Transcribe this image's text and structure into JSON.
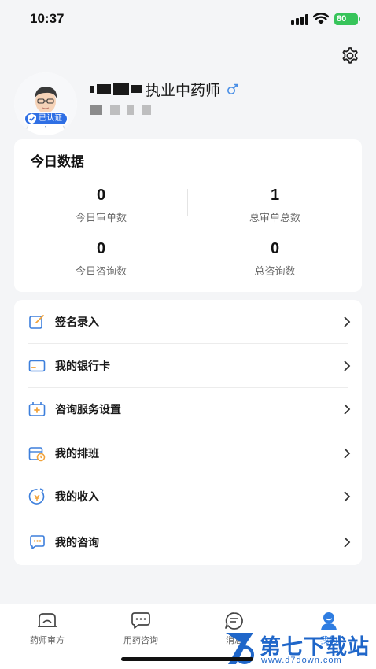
{
  "status_bar": {
    "time": "10:37",
    "battery": "80"
  },
  "profile": {
    "title": "执业中药师",
    "verified_label": "已认证"
  },
  "today_data": {
    "title": "今日数据",
    "stats": [
      {
        "value": "0",
        "label": "今日审单数"
      },
      {
        "value": "1",
        "label": "总审单总数"
      },
      {
        "value": "0",
        "label": "今日咨询数"
      },
      {
        "value": "0",
        "label": "总咨询数"
      }
    ]
  },
  "menu": [
    {
      "label": "签名录入",
      "icon": "signature-icon"
    },
    {
      "label": "我的银行卡",
      "icon": "bank-card-icon"
    },
    {
      "label": "咨询服务设置",
      "icon": "consult-settings-icon"
    },
    {
      "label": "我的排班",
      "icon": "schedule-icon"
    },
    {
      "label": "我的收入",
      "icon": "income-icon"
    },
    {
      "label": "我的咨询",
      "icon": "consultation-icon"
    }
  ],
  "tabs": [
    {
      "label": "药师审方"
    },
    {
      "label": "用药咨询"
    },
    {
      "label": "消息"
    },
    {
      "label": "我的"
    }
  ],
  "watermark": {
    "text": "第七下载站",
    "url": "www.d7down.com"
  },
  "colors": {
    "accent": "#2f7de1",
    "badge": "#2f6fe4",
    "battery": "#37c45a",
    "watermark": "#1f66c9"
  }
}
